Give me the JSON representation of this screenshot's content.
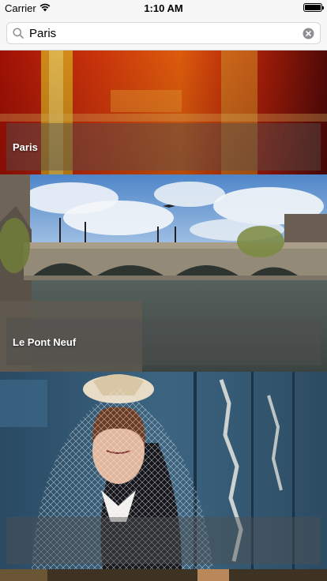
{
  "status_bar": {
    "carrier": "Carrier",
    "time": "1:10 AM",
    "battery_level": 1.0
  },
  "search": {
    "value": "Paris",
    "icon": "search-icon",
    "clear_icon": "clear-icon"
  },
  "photos": [
    {
      "caption": "Paris",
      "accent": "#c21a08"
    },
    {
      "caption": "Le Pont Neuf",
      "accent": "#7ea7d8"
    },
    {
      "caption": "",
      "accent": "#2f4c66"
    },
    {
      "caption": "",
      "accent": "#4a3a20"
    }
  ]
}
